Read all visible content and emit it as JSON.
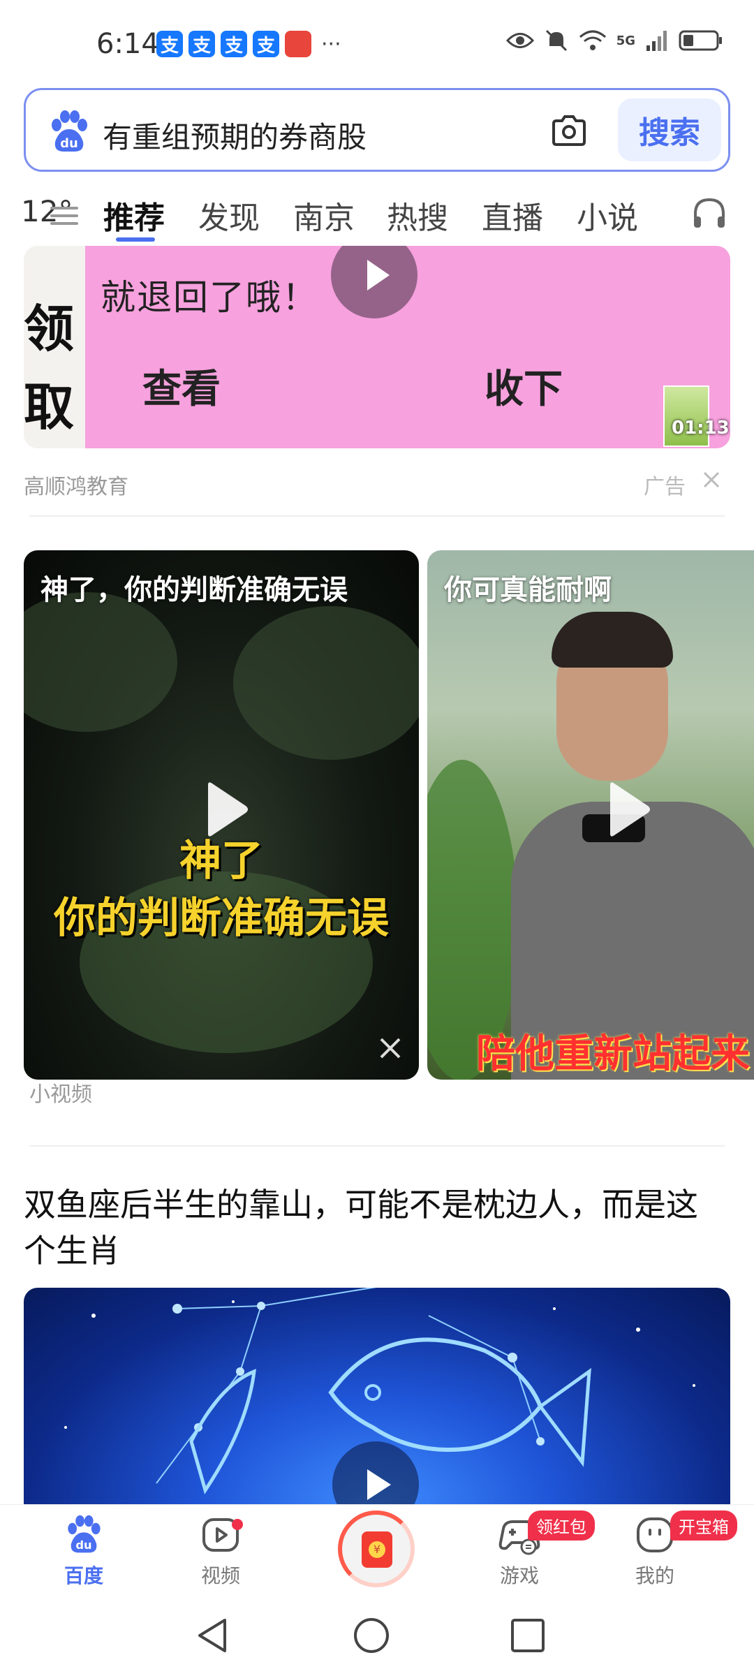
{
  "status_bar": {
    "time": "6:14",
    "app_icons": [
      "支",
      "支",
      "支",
      "支"
    ],
    "more": "···",
    "network": "5G",
    "icons": [
      "alipay-icon",
      "huawei-store-icon",
      "eye-icon",
      "mute-icon",
      "wifi-icon",
      "signal-icon",
      "battery-icon"
    ]
  },
  "search": {
    "query": "有重组预期的券商股",
    "button": "搜索"
  },
  "tabs": {
    "weather": "12°",
    "items": [
      "推荐",
      "发现",
      "南京",
      "热搜",
      "直播",
      "小说"
    ],
    "active": "推荐"
  },
  "ad": {
    "side_text": [
      "领",
      "取"
    ],
    "line1": "就退回了哦！",
    "view_label": "查看",
    "take_label": "收下",
    "duration": "01:13",
    "source": "高顺鸿教育",
    "tag": "广告"
  },
  "video_grid": {
    "cards": [
      {
        "title": "神了，你的判断准确无误",
        "caption_line1": "神了",
        "caption_line2": "你的判断准确无误"
      },
      {
        "title": "你可真能耐啊",
        "caption": "陪他重新站起来"
      }
    ],
    "label": "小视频"
  },
  "article": {
    "title": "双鱼座后半生的靠山，可能不是枕边人，而是这个生肖"
  },
  "bottom_nav": {
    "items": [
      {
        "label": "百度",
        "active": true
      },
      {
        "label": "视频",
        "active": false
      },
      {
        "label": "游戏",
        "badge": "领红包"
      },
      {
        "label": "我的",
        "badge": "开宝箱"
      }
    ]
  },
  "colors": {
    "accent": "#4a6ff0",
    "ad_pink": "#f7a1de",
    "badge_red": "#f0304a",
    "caption_yellow": "#f6d22c"
  }
}
